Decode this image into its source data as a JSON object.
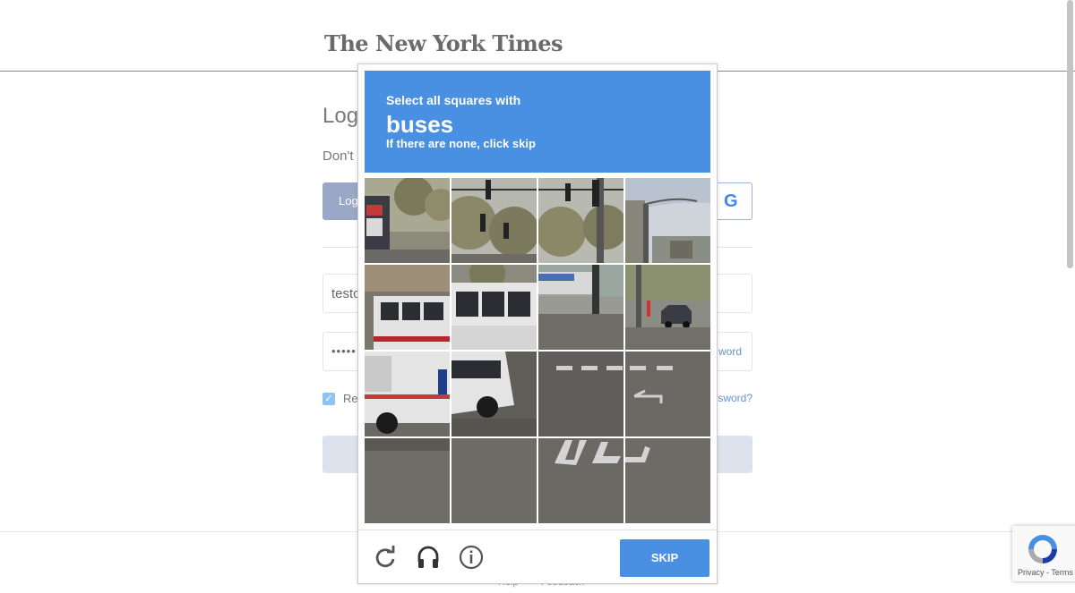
{
  "page": {
    "logo_text": "The New York Times",
    "title": "Log",
    "signup_prompt": "Don't",
    "login_button_label": "Log",
    "google_glyph": "G",
    "email_value": "testc",
    "password_dots": "•••••",
    "show_password_label": "word",
    "remember_label": "Re",
    "remember_checked": true,
    "forgot_label": "sword?",
    "footer_links": [
      "Help",
      "Feedback"
    ]
  },
  "captcha": {
    "instruction_line1": "Select all squares with",
    "keyword": "buses",
    "instruction_line3": "If there are none, click skip",
    "grid_rows": 4,
    "grid_cols": 4,
    "skip_label": "SKIP",
    "icons": [
      "reload-icon",
      "headphones-icon",
      "info-icon"
    ],
    "accent_color": "#4a90e2"
  },
  "recaptcha_badge": {
    "terms_text": "Privacy - Terms"
  }
}
